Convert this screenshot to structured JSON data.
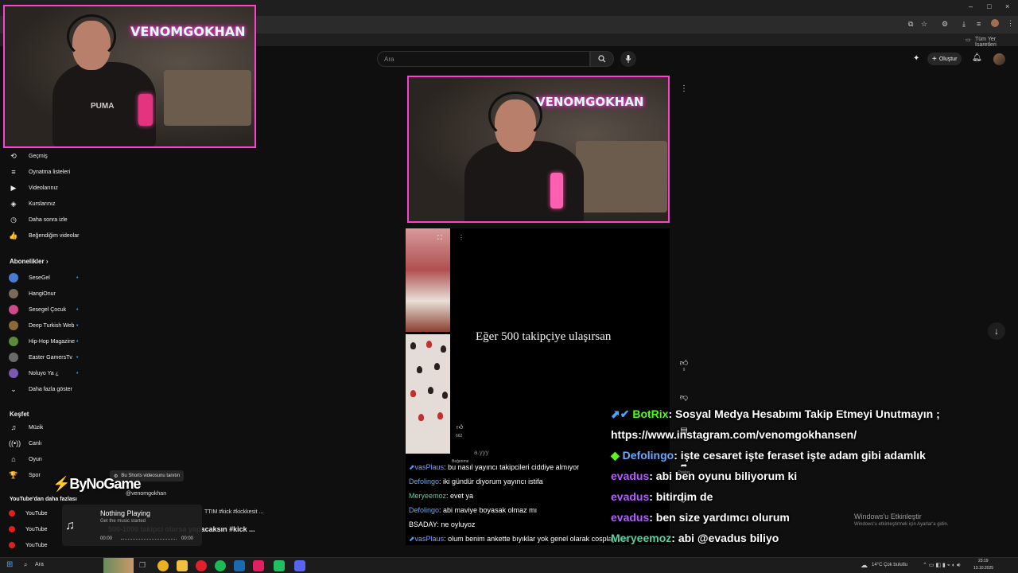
{
  "browser": {
    "bookmarks_label": "Tüm Yer İşaretleri",
    "window_controls": [
      "–",
      "□",
      "×"
    ]
  },
  "header": {
    "search_placeholder": "Ara",
    "create_label": "Oluştur"
  },
  "cam_overlay": {
    "neon_text": "VENOMGOKHAN",
    "shirt_text": "PUMA"
  },
  "sidebar": {
    "you_items": [
      {
        "icon": "history-icon",
        "glyph": "⟲",
        "label": "Geçmiş"
      },
      {
        "icon": "playlist-icon",
        "glyph": "≡",
        "label": "Oynatma listeleri"
      },
      {
        "icon": "video-icon",
        "glyph": "▶",
        "label": "Videolarınız"
      },
      {
        "icon": "course-icon",
        "glyph": "◈",
        "label": "Kurslarınız"
      },
      {
        "icon": "watch-later-icon",
        "glyph": "◷",
        "label": "Daha sonra izle"
      },
      {
        "icon": "like-icon",
        "glyph": "👍",
        "label": "Beğendiğim videolar"
      }
    ],
    "subscriptions_title": "Abonelikler",
    "subscriptions": [
      {
        "label": "SeseGel",
        "color": "#4a7bd0",
        "dot": true
      },
      {
        "label": "HangiOnur",
        "color": "#7a6a5a",
        "dot": false
      },
      {
        "label": "Sesegel Çocuk",
        "color": "#d04a8a",
        "dot": true
      },
      {
        "label": "Deep Turkish Web",
        "color": "#8a6a3a",
        "dot": true
      },
      {
        "label": "Hip-Hop Magazine",
        "color": "#5a8a3a",
        "dot": true
      },
      {
        "label": "Easter GamersTv",
        "color": "#6a6a6a",
        "dot": true
      },
      {
        "label": "Noluyo Ya ¿",
        "color": "#7a5ab0",
        "dot": true
      }
    ],
    "show_more": "Daha fazla göster",
    "explore_title": "Keşfet",
    "explore_items": [
      {
        "icon": "music-icon",
        "glyph": "♫",
        "label": "Müzik"
      },
      {
        "icon": "live-icon",
        "glyph": "((•))",
        "label": "Canlı"
      },
      {
        "icon": "gaming-icon",
        "glyph": "⌂",
        "label": "Oyun"
      },
      {
        "icon": "sports-icon",
        "glyph": "🏆",
        "label": "Spor"
      }
    ],
    "more_from_youtube": "YouTube'dan daha fazlası",
    "youtube_items": [
      "YouTube",
      "YouTube",
      "YouTube"
    ]
  },
  "short": {
    "caption": "Eğer 500 takipçiye ulaşırsan",
    "channel": "@venomgokhan",
    "like_count": "9",
    "share_label": "Paylaş",
    "small_like_count": "662",
    "small_dislike_label": "Beğenme",
    "handle_partial": "a.yyy",
    "title_fragments": [
      "TTIM #kick #kickkesit ...",
      "500-1000 takipci olursa yapacaksın #kick ..."
    ]
  },
  "now_playing": {
    "brand": "ByNoGame",
    "tooltip": "Bu Shorts videosunu tanıtın",
    "status": "Nothing Playing",
    "subtitle": "Get the music started",
    "time_start": "00:00",
    "time_end": "00:00"
  },
  "chat_small": [
    {
      "user": "vasPlaus",
      "color": "#8a9bff",
      "text": ": bu nasıl yayıncı takipcileri ciddiye almıyor"
    },
    {
      "user": "Defolingo",
      "color": "#6aaaff",
      "text": ": iki gündür diyorum yayıncı istifa"
    },
    {
      "user": "Meryeemoz",
      "color": "#5ad0a0",
      "text": ": evet ya"
    },
    {
      "user": "Defolingo",
      "color": "#6aaaff",
      "text": ": abi maviye boyasak olmaz mı"
    },
    {
      "user": "BSADAY",
      "color": "#ffffff",
      "text": ": ne oyluyoz"
    },
    {
      "user": "vasPlaus",
      "color": "#8a9bff",
      "text": ": olum benim ankette bıyıklar yok genel olarak cosplay var"
    }
  ],
  "chat_big": [
    {
      "badge": "kick-badge-icon",
      "user": "BotRix",
      "color": "#53fc18",
      "text": ": Sosyal Medya Hesabımı Takip Etmeyi Unutmayın ;"
    },
    {
      "badge": "",
      "user": "",
      "color": "#ffffff",
      "text": "https://www.instagram.com/venomgokhansen/"
    },
    {
      "badge": "diamond-badge-icon",
      "user": "Defolingo",
      "color": "#6aaaff",
      "text": ": işte cesaret işte feraset işte adam gibi adamlık"
    },
    {
      "badge": "",
      "user": "evadus",
      "color": "#b45cff",
      "text": ": abi ben oyunu biliyorum ki"
    },
    {
      "badge": "",
      "user": "evadus",
      "color": "#b45cff",
      "text": ": bitirdim de"
    },
    {
      "badge": "",
      "user": "evadus",
      "color": "#b45cff",
      "text": ": ben size yardımcı olurum"
    },
    {
      "badge": "",
      "user": "Meryeemoz",
      "color": "#5ad0a0",
      "text": ": abi @evadus biliyo"
    }
  ],
  "windows_activation": {
    "title": "Windows'u Etkinleştir",
    "subtitle": "Windows'u etkinleştirmek için Ayarlar'a gidin."
  },
  "taskbar": {
    "search_placeholder": "Ara",
    "weather": "14°C  Çok bulutlu",
    "time": "23:19",
    "date": "13.10.2025"
  }
}
